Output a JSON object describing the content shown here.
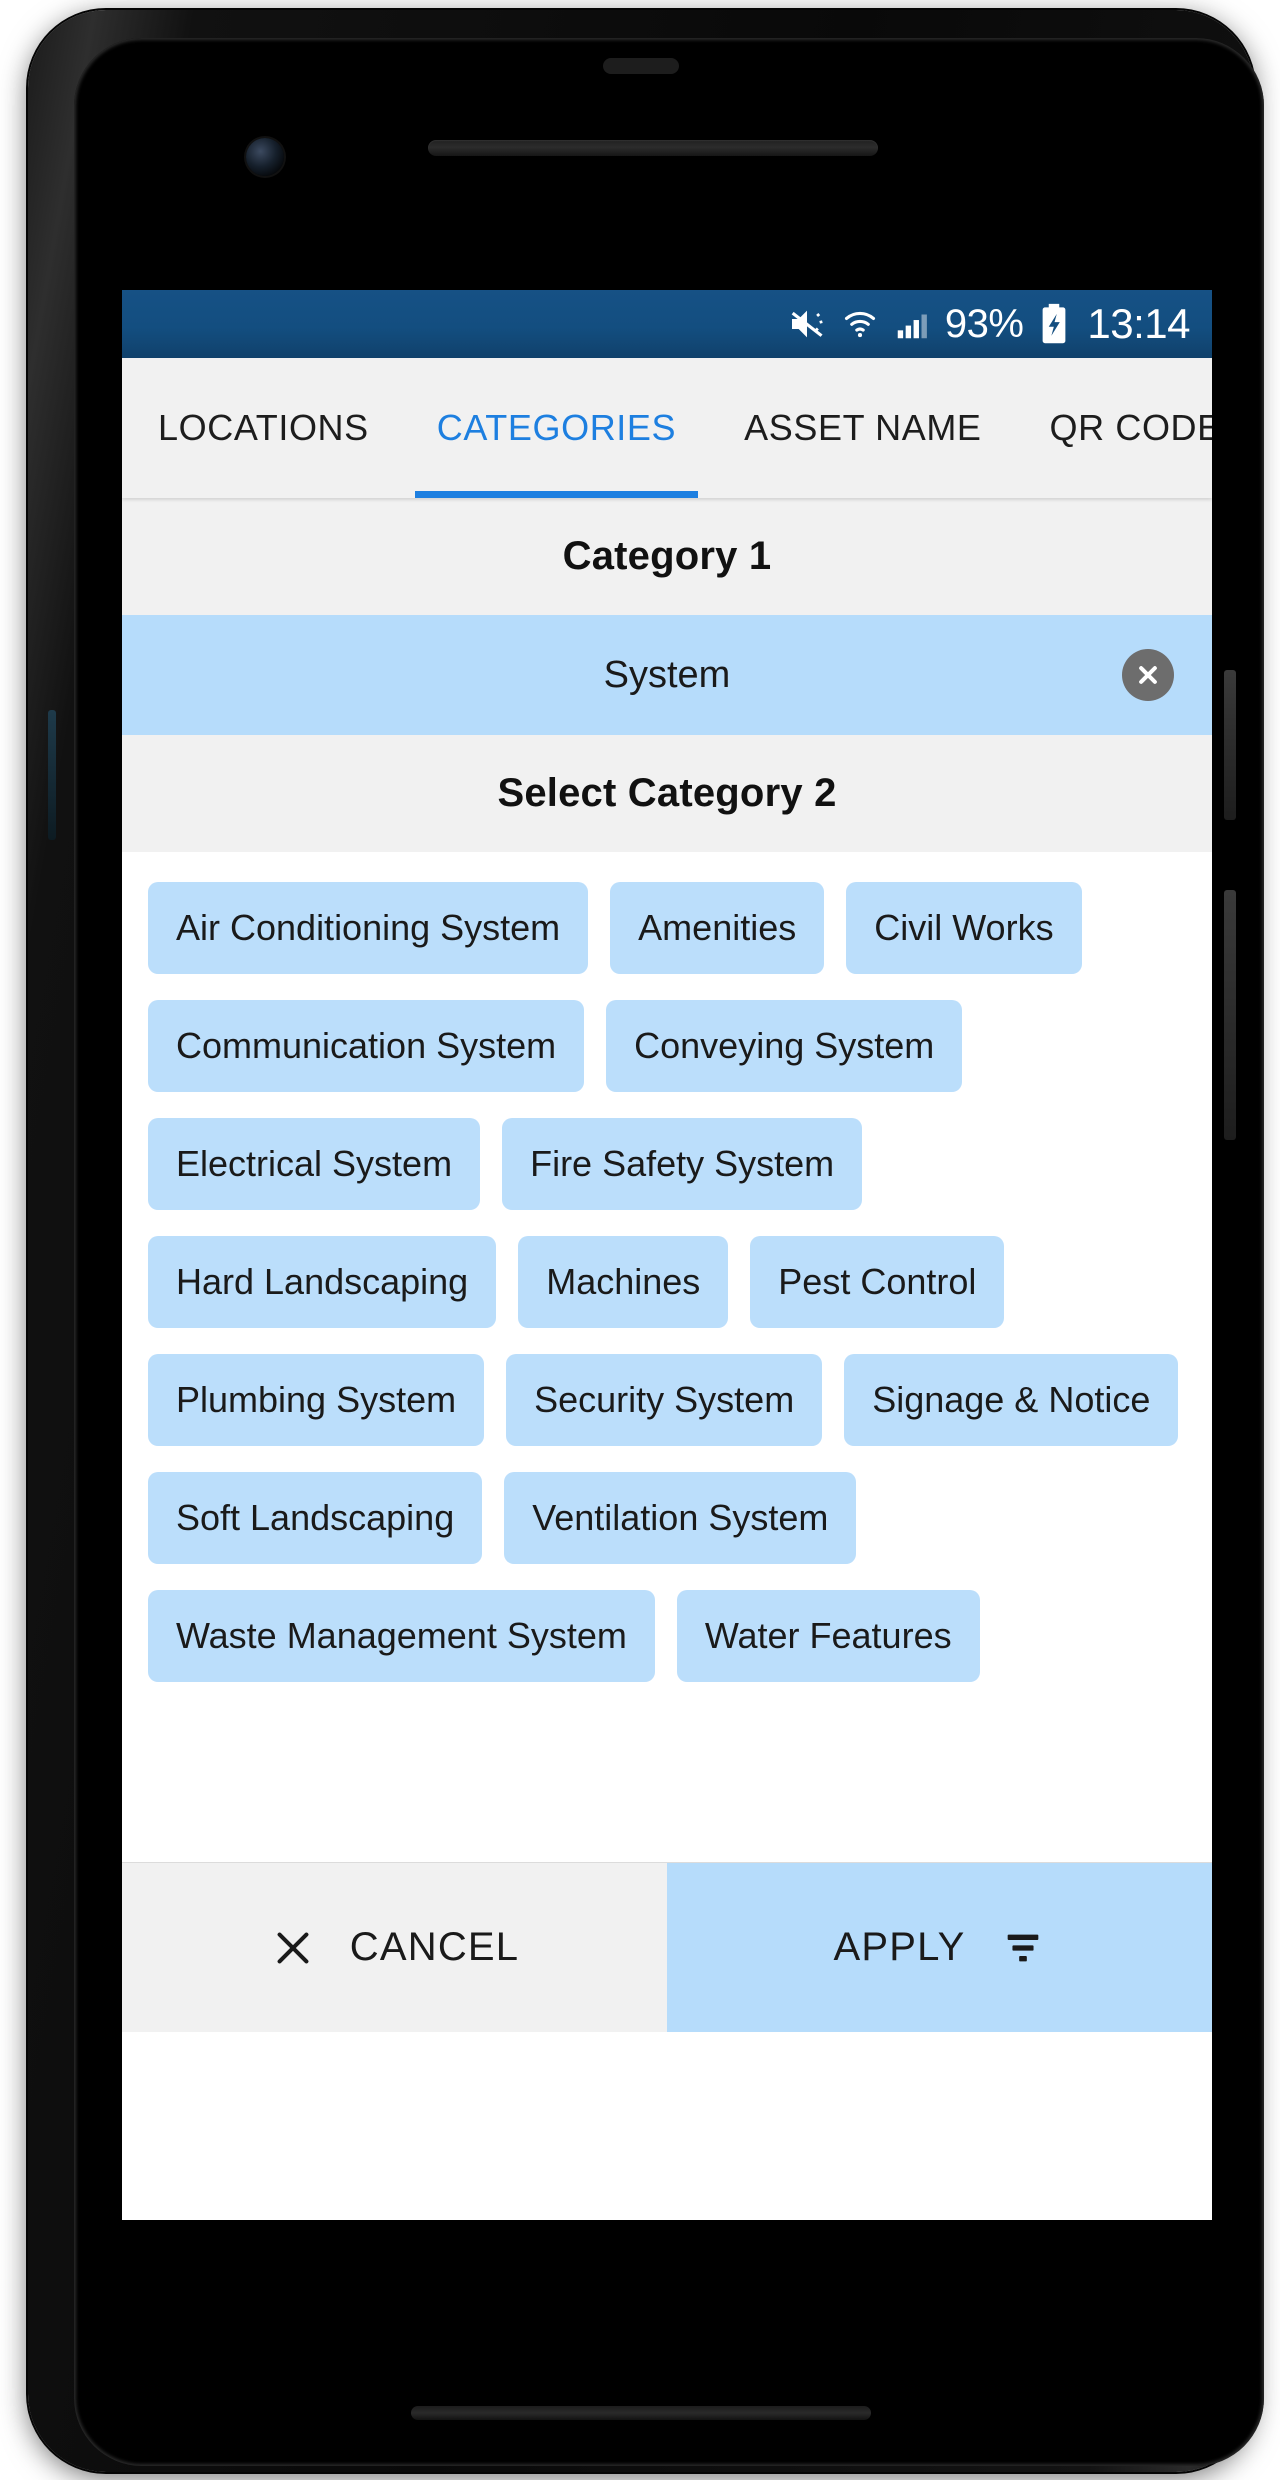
{
  "status_bar": {
    "battery_percent": "93%",
    "time": "13:14",
    "icons": [
      "mute-icon",
      "wifi-icon",
      "cellular-signal-icon",
      "battery-charging-icon"
    ],
    "background_color": "#134e80"
  },
  "tabs": [
    {
      "label": "LOCATIONS",
      "active": false
    },
    {
      "label": "CATEGORIES",
      "active": true
    },
    {
      "label": "ASSET NAME",
      "active": false
    },
    {
      "label": "QR CODE",
      "active": false
    }
  ],
  "category_1": {
    "header": "Category 1",
    "selected_value": "System",
    "clear_icon": "close-circle-icon"
  },
  "category_2": {
    "header": "Select Category 2",
    "options": [
      "Air Conditioning System",
      "Amenities",
      "Civil Works",
      "Communication System",
      "Conveying System",
      "Electrical System",
      "Fire Safety System",
      "Hard Landscaping",
      "Machines",
      "Pest Control",
      "Plumbing System",
      "Security System",
      "Signage & Notice",
      "Soft Landscaping",
      "Ventilation System",
      "Waste Management System",
      "Water Features"
    ]
  },
  "actions": {
    "cancel_label": "CANCEL",
    "cancel_icon": "close-icon",
    "apply_label": "APPLY",
    "apply_icon": "filter-icon"
  },
  "colors": {
    "accent_blue": "#1d7fe0",
    "status_bar_blue": "#134e80",
    "chip_blue": "#bbdefb",
    "selected_row_blue": "#b6dcfb",
    "panel_grey": "#f1f1f1"
  }
}
